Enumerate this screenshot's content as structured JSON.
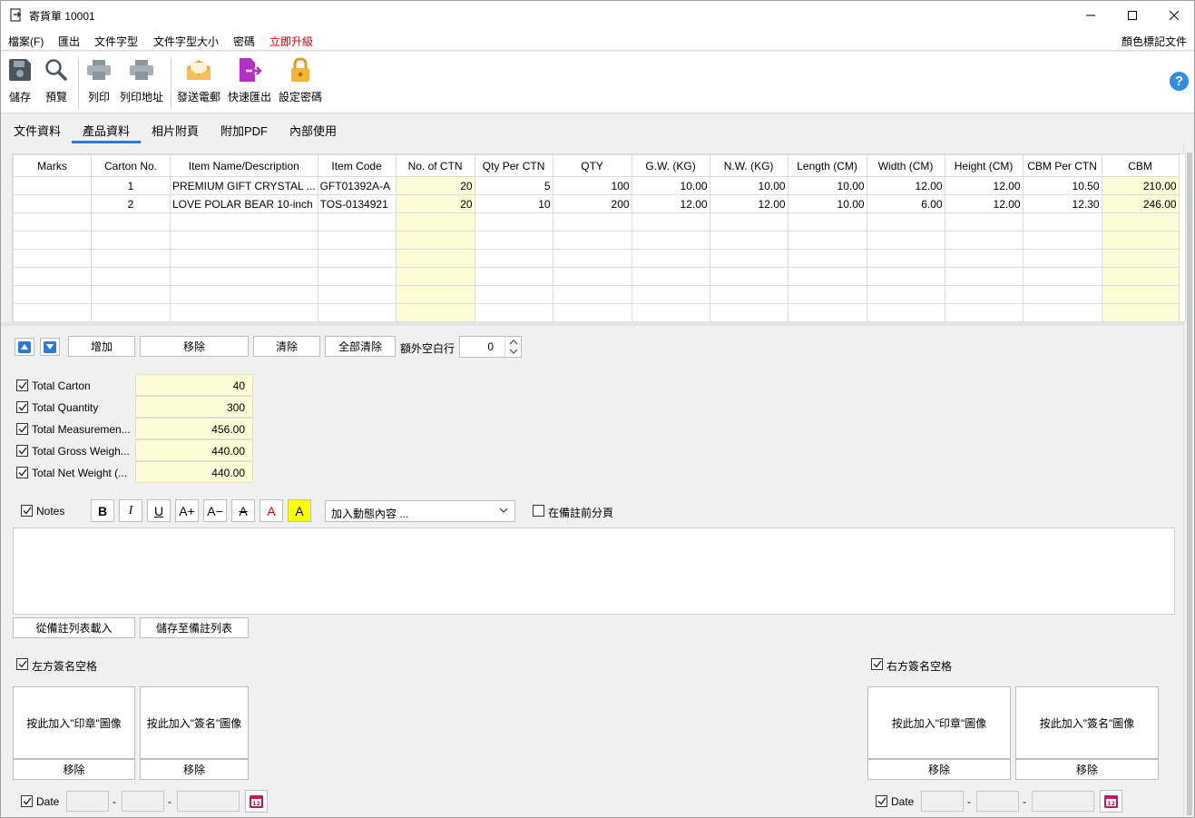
{
  "window": {
    "title": "寄貨單 10001"
  },
  "menu": {
    "file": "檔案(F)",
    "export": "匯出",
    "font": "文件字型",
    "font_size": "文件字型大小",
    "password": "密碼",
    "upgrade": "立即升級",
    "color_tag": "顏色標記文件"
  },
  "toolbar": {
    "save": "儲存",
    "preview": "預覽",
    "print": "列印",
    "print_address": "列印地址",
    "send_email": "發送電郵",
    "quick_export": "快速匯出",
    "set_password": "設定密碼"
  },
  "tabs": [
    "文件資料",
    "產品資料",
    "相片附頁",
    "附加PDF",
    "內部使用"
  ],
  "grid": {
    "columns": [
      "Marks",
      "Carton No.",
      "Item Name/Description",
      "Item Code",
      "No. of CTN",
      "Qty Per CTN",
      "QTY",
      "G.W. (KG)",
      "N.W. (KG)",
      "Length (CM)",
      "Width (CM)",
      "Height (CM)",
      "CBM Per CTN",
      "CBM"
    ],
    "rows": [
      [
        "",
        "1",
        "PREMIUM GIFT CRYSTAL ...",
        "GFT01392A-A",
        "20",
        "5",
        "100",
        "10.00",
        "10.00",
        "10.00",
        "12.00",
        "12.00",
        "10.50",
        "210.00"
      ],
      [
        "",
        "2",
        "LOVE POLAR BEAR 10-inch",
        "TOS-0134921",
        "20",
        "10",
        "200",
        "12.00",
        "12.00",
        "10.00",
        "6.00",
        "12.00",
        "12.30",
        "246.00"
      ]
    ],
    "empty_rows": 6
  },
  "actions": {
    "add": "增加",
    "remove": "移除",
    "clear": "清除",
    "clear_all": "全部清除",
    "extra_blank_lines_label": "額外空白行",
    "extra_blank_lines_value": "0"
  },
  "totals": [
    {
      "label": "Total Carton",
      "value": "40"
    },
    {
      "label": "Total Quantity",
      "value": "300"
    },
    {
      "label": "Total Measuremen...",
      "value": "456.00"
    },
    {
      "label": "Total Gross Weigh...",
      "value": "440.00"
    },
    {
      "label": "Total Net Weight (...",
      "value": "440.00"
    }
  ],
  "notes": {
    "label": "Notes",
    "dynamic_content_placeholder": "加入動態內容 ...",
    "page_break_label": "在備註前分頁",
    "load_from_list": "從備註列表載入",
    "save_to_list": "儲存至備註列表",
    "text": ""
  },
  "signature": {
    "left_label": "左方簽名空格",
    "right_label": "右方簽名空格",
    "add_stamp": "按此加入\"印章\"圖像",
    "add_signature": "按此加入\"簽名\"圖像",
    "remove": "移除",
    "date_label": "Date",
    "date_sep": "-"
  },
  "colors": {
    "accent": "#2b7bd3",
    "highlight_cell": "#fbfbd5",
    "upgrade": "#e00000"
  }
}
